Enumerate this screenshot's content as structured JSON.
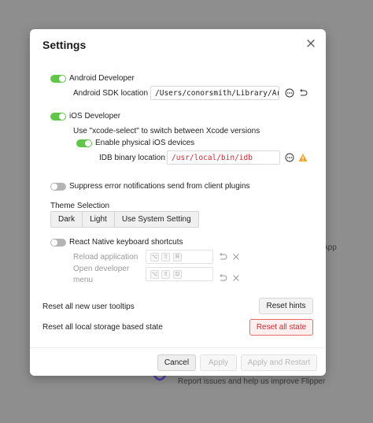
{
  "background": {
    "feedback_text": "Report issues and help us improve Flipper",
    "app_text": "App"
  },
  "dialog": {
    "title": "Settings",
    "close_icon": "close-icon"
  },
  "android": {
    "label": "Android Developer",
    "enabled": true,
    "sdk_label": "Android SDK location",
    "sdk_value": "/Users/conorsmith/Library/Ar"
  },
  "ios": {
    "label": "iOS Developer",
    "enabled": true,
    "hint": "Use \"xcode-select\" to switch between Xcode versions",
    "physical_label": "Enable physical iOS devices",
    "physical_enabled": true,
    "idb_label": "IDB binary location",
    "idb_value": "/usr/local/bin/idb"
  },
  "suppress": {
    "label": "Suppress error notifications send from client plugins",
    "enabled": false
  },
  "theme": {
    "label": "Theme Selection",
    "options": [
      "Dark",
      "Light",
      "Use System Setting"
    ]
  },
  "react_native": {
    "label": "React Native keyboard shortcuts",
    "enabled": false,
    "reload_label": "Reload application",
    "reload_keys": [
      "⌥",
      "⇧",
      "R"
    ],
    "devmenu_label": "Open developer menu",
    "devmenu_keys": [
      "⌥",
      "⇧",
      "D"
    ]
  },
  "reset": {
    "hints_text": "Reset all new user tooltips",
    "hints_button": "Reset hints",
    "state_text": "Reset all local storage based state",
    "state_button": "Reset all state"
  },
  "footer": {
    "cancel": "Cancel",
    "apply": "Apply",
    "apply_restart": "Apply and Restart"
  },
  "colors": {
    "toggle_on": "#5fc649",
    "toggle_off": "#b5b5b5",
    "danger": "#d8262f",
    "warning": "#f2a431"
  }
}
